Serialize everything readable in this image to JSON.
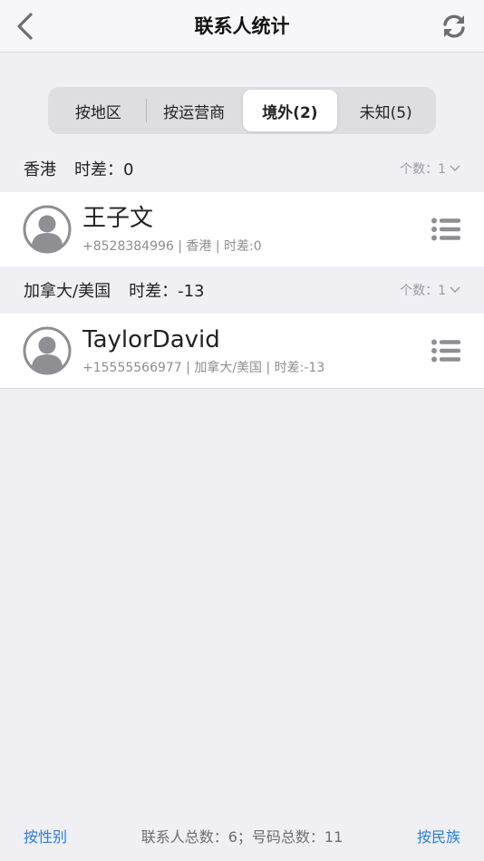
{
  "navbar": {
    "title": "联系人统计",
    "back_icon": "chevron-left-icon",
    "refresh_icon": "refresh-icon"
  },
  "segments": [
    {
      "label": "按地区",
      "active": false
    },
    {
      "label": "按运营商",
      "active": false
    },
    {
      "label": "境外(2)",
      "active": true
    },
    {
      "label": "未知(5)",
      "active": false
    }
  ],
  "groups": [
    {
      "region": "香港",
      "offset": "时差：0",
      "count": "个数：1",
      "contact": {
        "name": "王子文",
        "meta": "+8528384996 | 香港 | 时差:0"
      }
    },
    {
      "region": "加拿大/美国",
      "offset": "时差：-13",
      "count": "个数：1",
      "contact": {
        "name": "TaylorDavid",
        "meta": "+15555566977 | 加拿大/美国 | 时差:-13"
      }
    }
  ],
  "footer": {
    "left_link": "按性别",
    "stats": "联系人总数：6；号码总数：11",
    "right_link": "按民族"
  },
  "colors": {
    "background": "#efeff4",
    "accent": "#2a7fd4",
    "icon_gray": "#8e8e93"
  }
}
